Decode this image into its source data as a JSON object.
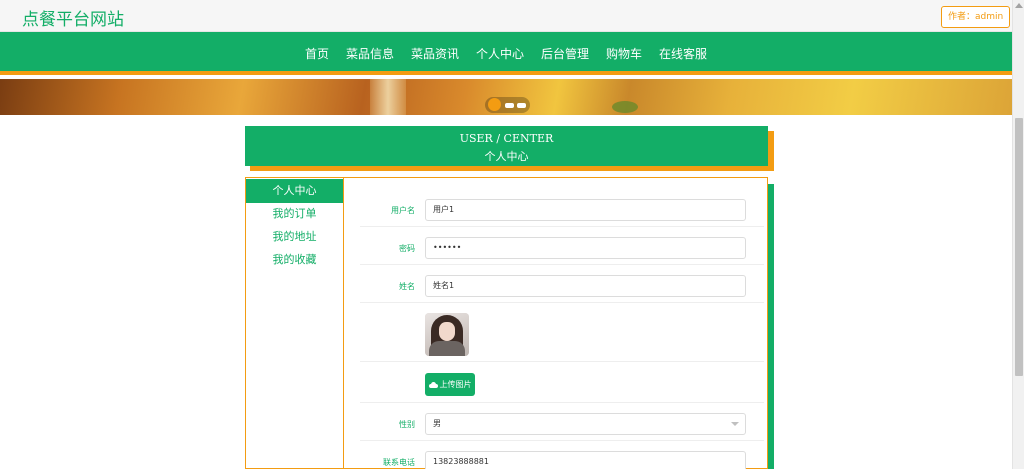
{
  "site": {
    "title": "点餐平台网站",
    "author_badge": "作者：admin"
  },
  "nav": {
    "items": [
      "首页",
      "菜品信息",
      "菜品资讯",
      "个人中心",
      "后台管理",
      "购物车",
      "在线客服"
    ]
  },
  "section": {
    "title_en": "USER / CENTER",
    "title_cn": "个人中心"
  },
  "sidebar": {
    "items": [
      "个人中心",
      "我的订单",
      "我的地址",
      "我的收藏"
    ],
    "active_index": 0
  },
  "form": {
    "username": {
      "label": "用户名",
      "value": "用户1"
    },
    "password": {
      "label": "密码",
      "value": "••••••"
    },
    "name": {
      "label": "姓名",
      "value": "姓名1"
    },
    "upload_label": "上传图片",
    "gender": {
      "label": "性别",
      "value": "男"
    },
    "phone": {
      "label": "联系电话",
      "value": "13823888881"
    }
  },
  "colors": {
    "primary": "#13ae67",
    "accent": "#f39c12"
  }
}
